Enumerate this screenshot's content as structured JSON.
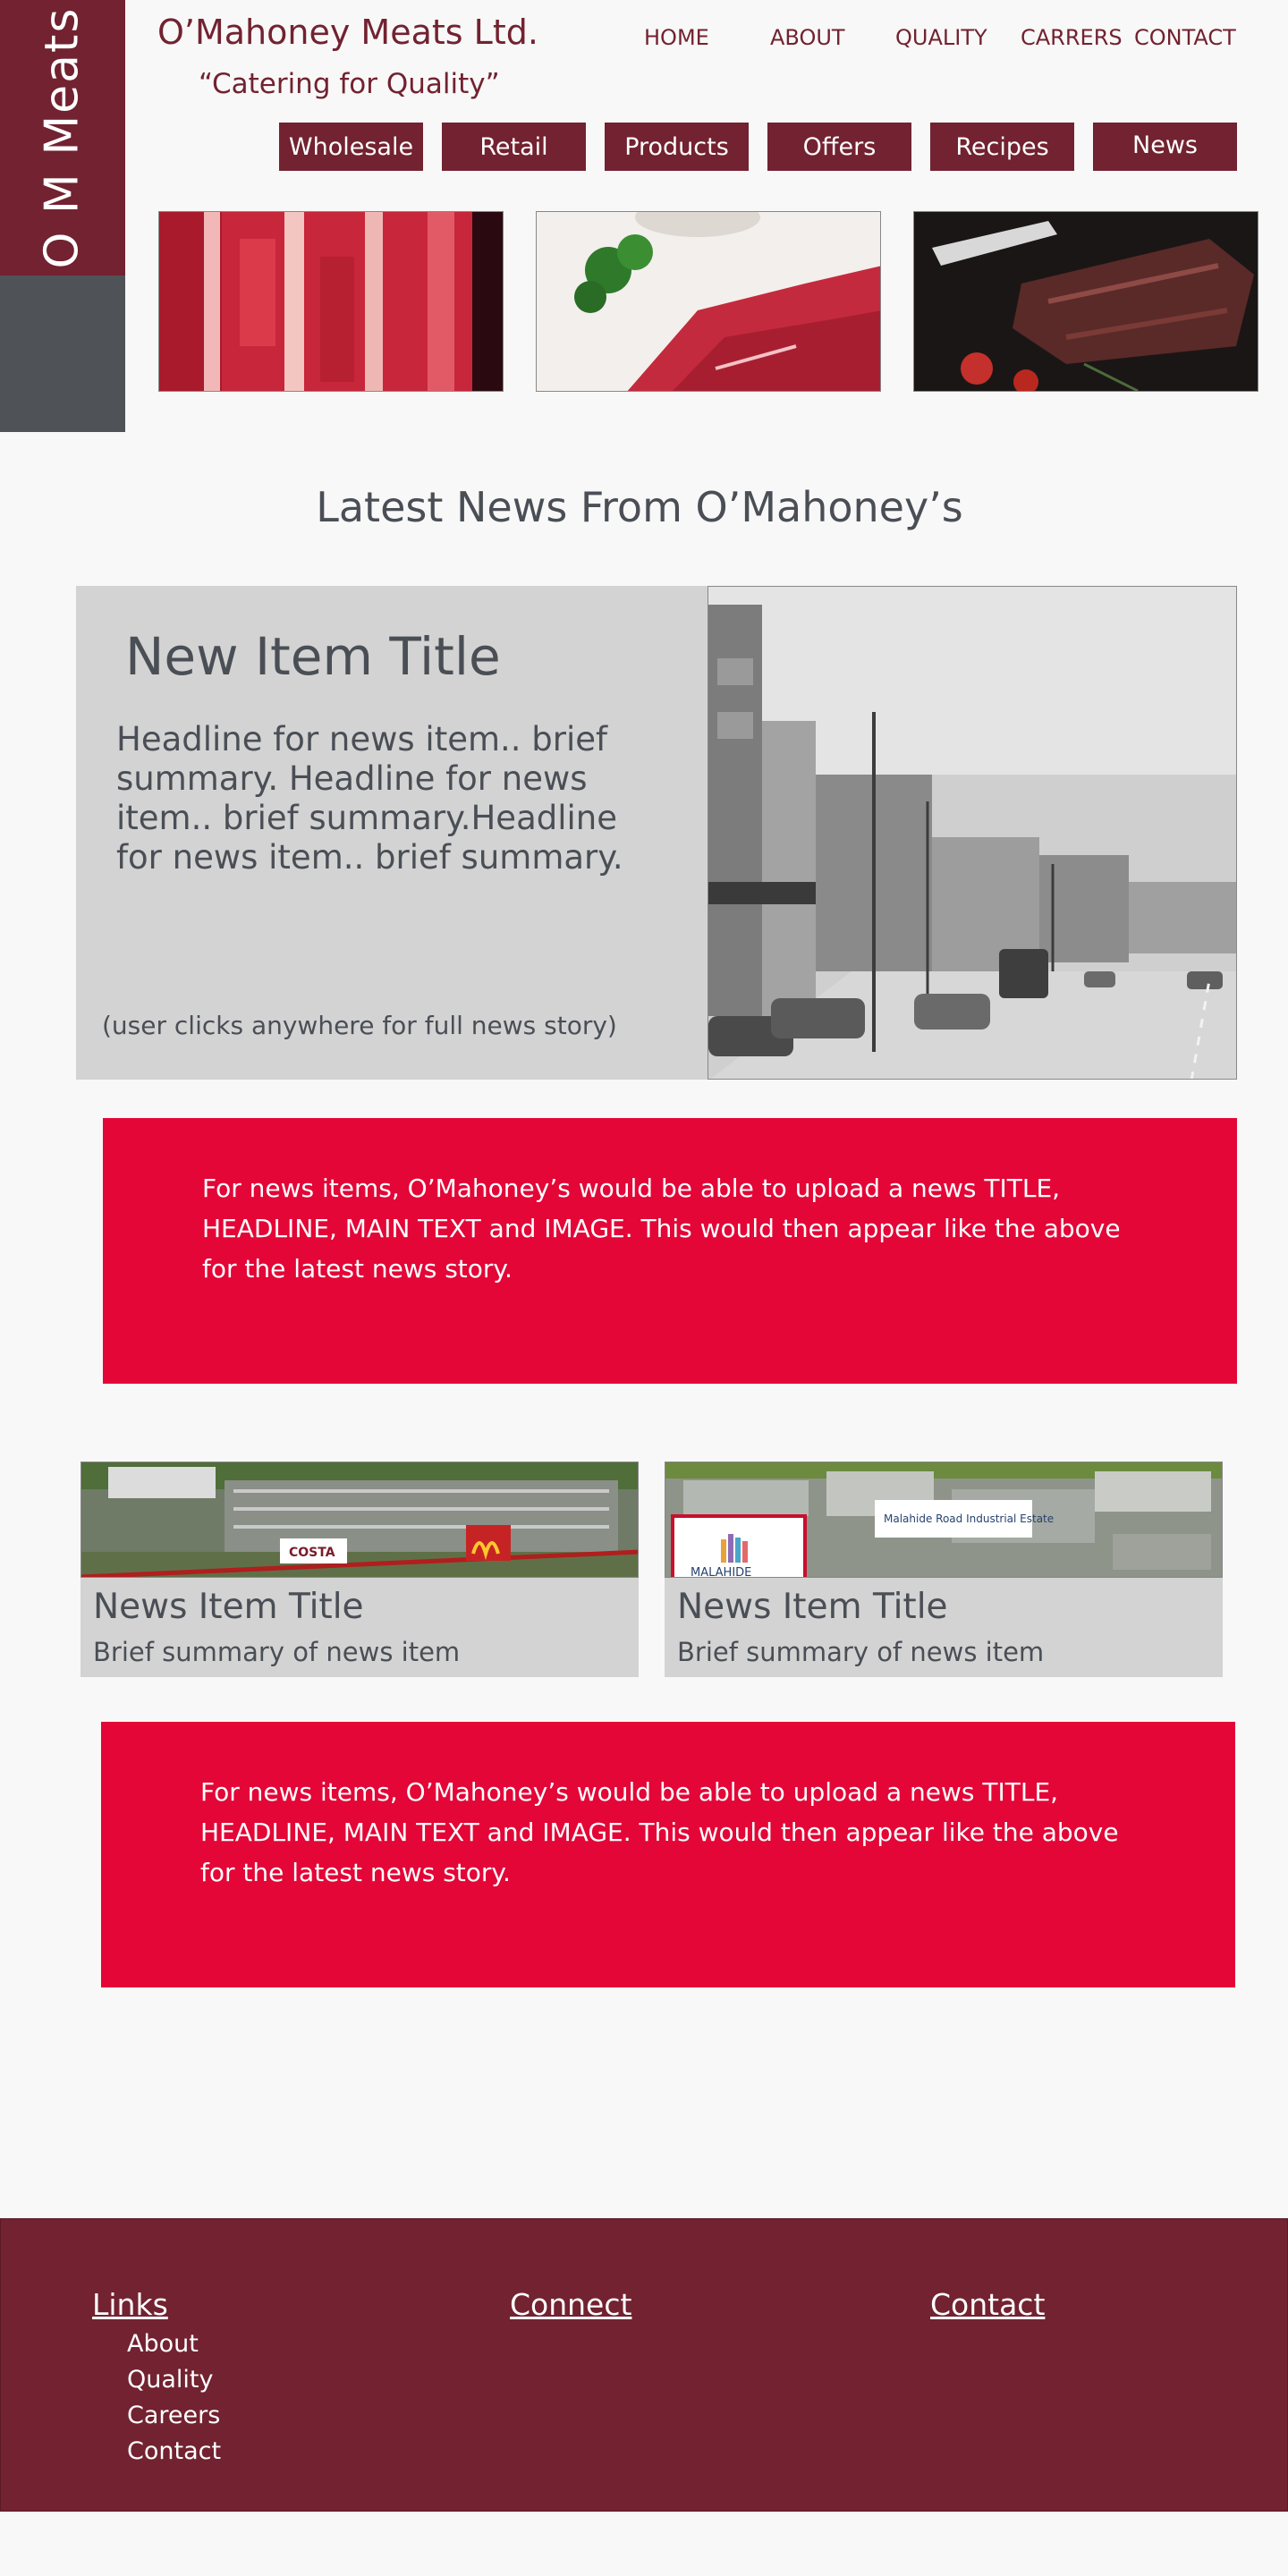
{
  "brand": {
    "vertical_text": "O M Meats",
    "company_name": "O’Mahoney Meats Ltd.",
    "tagline": "“Catering for Quality”"
  },
  "top_nav": [
    "HOME",
    "ABOUT",
    "QUALITY",
    "CARRERS",
    "CONTACT"
  ],
  "sub_nav": [
    "Wholesale",
    "Retail",
    "Products",
    "Offers",
    "Recipes",
    "News"
  ],
  "hero_images": [
    "raw-ribs-image",
    "steak-with-parsley-image",
    "grilled-ribs-image"
  ],
  "section_title": "Latest News From O’Mahoney’s",
  "feature": {
    "title": "New Item Title",
    "headline": "Headline for news item.. brief summary. Headline for news item.. brief summary.Headline for news item.. brief summary.",
    "hint": "(user clicks anywhere for full news story)",
    "image": "street-photo-image"
  },
  "info_text_1": "For news items, O’Mahoney’s would be able to upload a news TITLE, HEADLINE, MAIN TEXT and IMAGE. This would then appear like the above for the latest news story.",
  "cards": [
    {
      "title": "News Item Title",
      "summary": "Brief summary of news item",
      "image": "retail-park-aerial-image"
    },
    {
      "title": "News Item Title",
      "summary": "Brief summary of news item",
      "image": "industrial-estate-aerial-image",
      "sign": "Malahide Road Industrial Estate",
      "logo": "MALAHIDE"
    }
  ],
  "info_text_2": "For news items, O’Mahoney’s would be able to upload a news TITLE, HEADLINE, MAIN TEXT and IMAGE. This would then appear like the above for the latest news story.",
  "footer": {
    "links_heading": "Links",
    "connect_heading": "Connect",
    "contact_heading": "Contact",
    "links": [
      "About",
      "Quality",
      "Careers",
      "Contact"
    ]
  },
  "colors": {
    "brand": "#722230",
    "grey": "#4f5257",
    "accent_red": "#e30637",
    "panel": "#d3d3d3"
  }
}
